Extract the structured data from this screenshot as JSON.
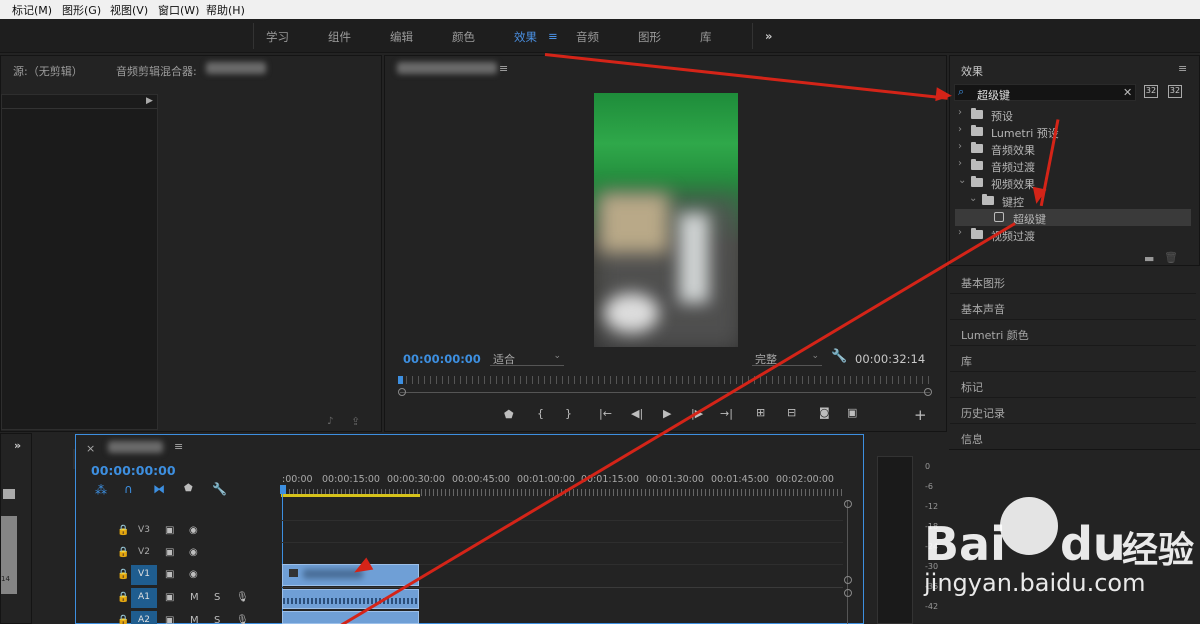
{
  "menubar": {
    "items": [
      "标记(M)",
      "图形(G)",
      "视图(V)",
      "窗口(W)",
      "帮助(H)"
    ]
  },
  "workspaces": {
    "items": [
      "学习",
      "组件",
      "编辑",
      "颜色",
      "效果",
      "音频",
      "图形",
      "库"
    ],
    "active": "效果",
    "menu_icon": "≡",
    "more_icon": "»"
  },
  "source_panel": {
    "tab_source": "源:（无剪辑）",
    "tab_audio_mixer": "音频剪辑混合器: "
  },
  "program_monitor": {
    "timecode_current": "00:00:00:00",
    "fit_label": "适合",
    "quality_label": "完整",
    "timecode_duration": "00:00:32:14"
  },
  "effects_panel": {
    "title": "效果",
    "search_value": "超级键",
    "tree": [
      {
        "label": "预设",
        "indent": 0,
        "expanded": false
      },
      {
        "label": "Lumetri 预设",
        "indent": 0,
        "expanded": false
      },
      {
        "label": "音频效果",
        "indent": 0,
        "expanded": false
      },
      {
        "label": "音频过渡",
        "indent": 0,
        "expanded": false
      },
      {
        "label": "视频效果",
        "indent": 0,
        "expanded": true
      },
      {
        "label": "键控",
        "indent": 1,
        "expanded": true
      },
      {
        "label": "超级键",
        "indent": 2,
        "selected": true
      },
      {
        "label": "视频过渡",
        "indent": 0,
        "expanded": false
      }
    ],
    "side_items": [
      "基本图形",
      "基本声音",
      "Lumetri 颜色",
      "库",
      "标记",
      "历史记录",
      "信息"
    ]
  },
  "timeline": {
    "timecode": "00:00:00:00",
    "ruler": [
      ":00:00",
      "00:00:15:00",
      "00:00:30:00",
      "00:00:45:00",
      "00:01:00:00",
      "00:01:15:00",
      "00:01:30:00",
      "00:01:45:00",
      "00:02:00:00"
    ],
    "tracks": [
      {
        "name": "V3",
        "target": false
      },
      {
        "name": "V2",
        "target": false
      },
      {
        "name": "V1",
        "target": true
      },
      {
        "name": "A1",
        "target": true,
        "audio": true
      },
      {
        "name": "A2",
        "target": true,
        "audio": true
      }
    ],
    "audio_m": "M",
    "audio_s": "S",
    "left_num": "14",
    "meter_scale": [
      "0",
      "-6",
      "-12",
      "-18",
      "-24",
      "-30",
      "-36",
      "-42"
    ]
  },
  "watermark": {
    "brand": "Bai",
    "brand2": "du",
    "cn": "经验",
    "url": "jingyan.baidu.com"
  },
  "colors": {
    "accent_blue": "#3d8fe0",
    "annotation_arrow": "#d42418",
    "clip_blue": "#6f9fd6"
  }
}
